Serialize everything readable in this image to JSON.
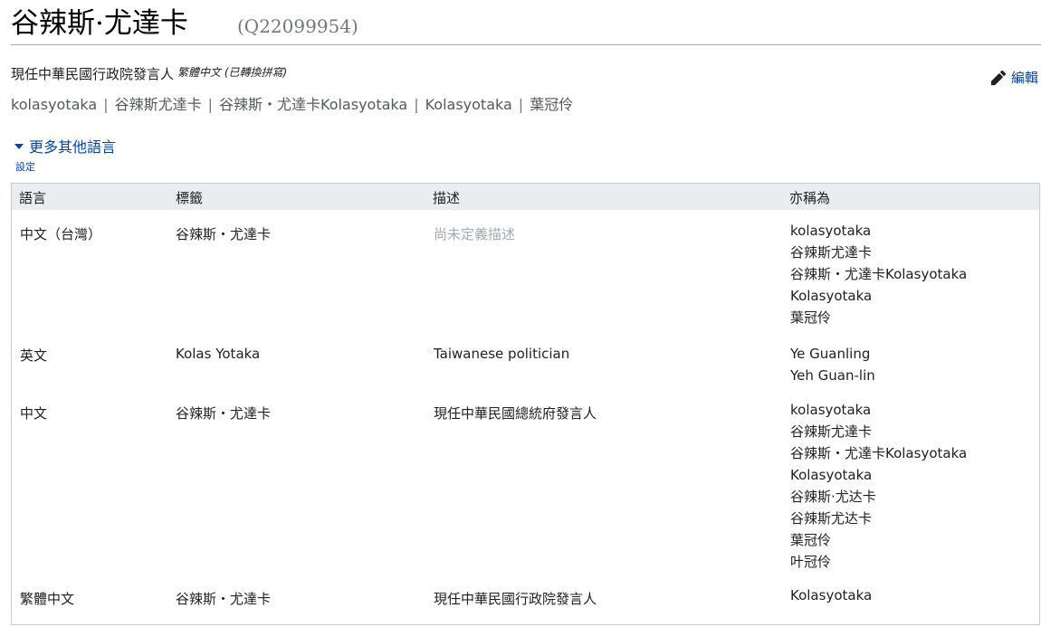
{
  "entity": {
    "label": "谷辣斯·尤達卡",
    "id": "(Q22099954)"
  },
  "description": {
    "text": "現任中華民國行政院發言人",
    "lang_note": "繁體中文 (已轉換拼寫)"
  },
  "aliases": [
    "kolasyotaka",
    "谷辣斯尤達卡",
    "谷辣斯・尤達卡Kolasyotaka",
    "Kolasyotaka",
    "葉冠伶"
  ],
  "alias_separator": "|",
  "edit": {
    "label": "編輯",
    "icon": "pencil-icon"
  },
  "more_languages": {
    "label": "更多其他語言",
    "icon": "triangle-down-icon"
  },
  "settings": {
    "label": "設定"
  },
  "table": {
    "headers": [
      "語言",
      "標籤",
      "描述",
      "亦稱為"
    ],
    "rows": [
      {
        "lang": "中文（台灣）",
        "label": "谷辣斯・尤達卡",
        "description": "尚未定義描述",
        "description_placeholder": true,
        "aliases": [
          "kolasyotaka",
          "谷辣斯尤達卡",
          "谷辣斯・尤達卡Kolasyotaka",
          "Kolasyotaka",
          "葉冠伶"
        ]
      },
      {
        "lang": "英文",
        "label": "Kolas Yotaka",
        "description": "Taiwanese politician",
        "description_placeholder": false,
        "aliases": [
          "Ye Guanling",
          "Yeh Guan-lin"
        ]
      },
      {
        "lang": "中文",
        "label": "谷辣斯・尤達卡",
        "description": "現任中華民國總統府發言人",
        "description_placeholder": false,
        "aliases": [
          "kolasyotaka",
          "谷辣斯尤達卡",
          "谷辣斯・尤達卡Kolasyotaka",
          "Kolasyotaka",
          "谷辣斯·尤达卡",
          "谷辣斯尤达卡",
          "葉冠伶",
          "叶冠伶"
        ]
      },
      {
        "lang": "繁體中文",
        "label": "谷辣斯・尤達卡",
        "description": "現任中華民國行政院發言人",
        "description_placeholder": false,
        "aliases": [
          "Kolasyotaka"
        ]
      }
    ]
  },
  "colors": {
    "link": "#0645ad",
    "header_bg": "#eaecf0",
    "placeholder": "#a2a9b1",
    "border": "#c8ccd1"
  }
}
